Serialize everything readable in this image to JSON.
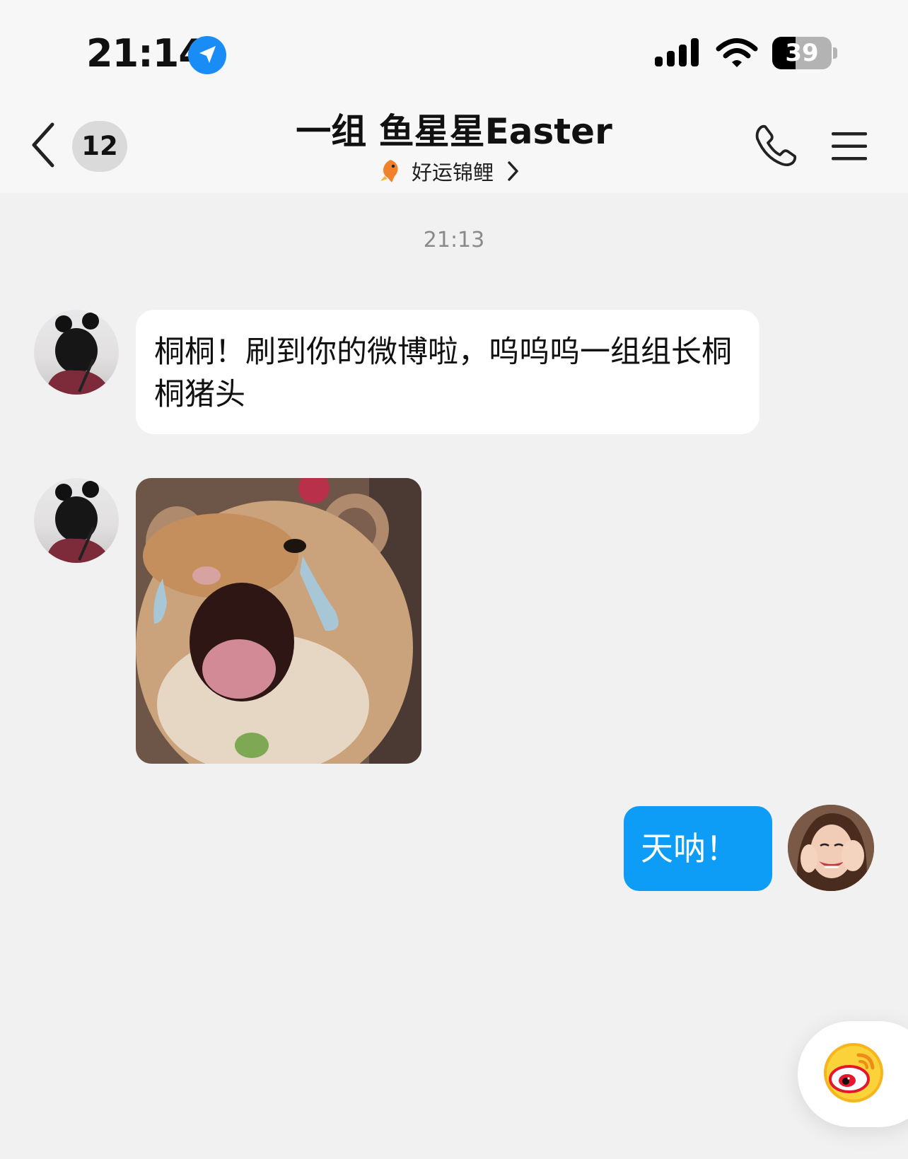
{
  "status_bar": {
    "time": "21:14",
    "battery_percent": "39",
    "battery_level": 0.39
  },
  "nav": {
    "unread_count": "12",
    "title": "一组 鱼星星Easter",
    "group_tag": "好运锦鲤"
  },
  "chat": {
    "timestamp": "21:13",
    "messages": [
      {
        "side": "left",
        "type": "text",
        "text": "桐桐！刷到你的微博啦，呜呜呜一组组长桐桐猪头"
      },
      {
        "side": "left",
        "type": "image",
        "image": "crying-hamster-sticker"
      },
      {
        "side": "right",
        "type": "text",
        "text": "天呐！"
      }
    ]
  },
  "colors": {
    "accent": "#0D9CF6",
    "location_blue": "#1A8CF5",
    "background": "#F1F1F1",
    "header": "#F7F7F7"
  },
  "icons": [
    "location-arrow-icon",
    "signal-icon",
    "wifi-icon",
    "battery-icon",
    "back-chevron-icon",
    "fish-icon",
    "chevron-right-icon",
    "phone-icon",
    "menu-icon",
    "weibo-icon"
  ]
}
